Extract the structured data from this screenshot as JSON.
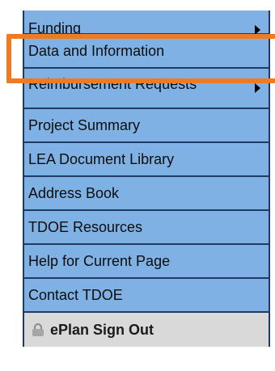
{
  "menu": {
    "items": [
      {
        "label": "Funding",
        "has_submenu": true
      },
      {
        "label": "Data and Information",
        "has_submenu": false,
        "highlighted": true
      },
      {
        "label": "Reimbursement Requests",
        "has_submenu": true
      },
      {
        "label": "Project Summary",
        "has_submenu": false
      },
      {
        "label": "LEA Document Library",
        "has_submenu": false
      },
      {
        "label": "Address Book",
        "has_submenu": false
      },
      {
        "label": "TDOE Resources",
        "has_submenu": false
      },
      {
        "label": "Help for Current Page",
        "has_submenu": false
      },
      {
        "label": "Contact TDOE",
        "has_submenu": false
      }
    ],
    "signout": {
      "label": "ePlan Sign Out",
      "icon": "lock-icon"
    }
  },
  "colors": {
    "menu_background": "#7fb1e4",
    "menu_border": "#1f3b63",
    "highlight": "#ee7a22",
    "signout_background": "#d9d9d9"
  }
}
